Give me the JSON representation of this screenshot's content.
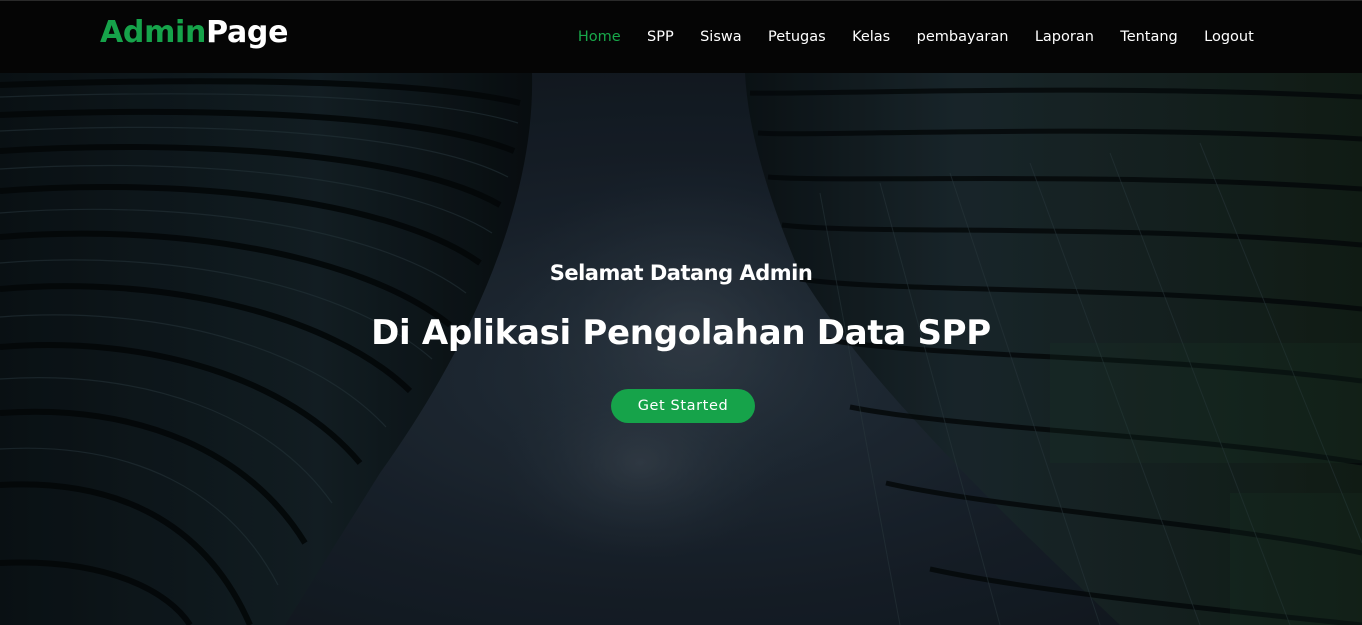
{
  "brand": {
    "part1": "Admin",
    "part2": "Page"
  },
  "nav": {
    "items": [
      {
        "label": "Home",
        "active": true
      },
      {
        "label": "SPP"
      },
      {
        "label": "Siswa"
      },
      {
        "label": "Petugas"
      },
      {
        "label": "Kelas"
      },
      {
        "label": "pembayaran"
      },
      {
        "label": "Laporan"
      },
      {
        "label": "Tentang"
      },
      {
        "label": "Logout"
      }
    ]
  },
  "hero": {
    "welcome": "Selamat Datang Admin",
    "subtitle": "Di Aplikasi Pengolahan Data SPP",
    "cta_label": "Get Started"
  },
  "colors": {
    "accent": "#16a34a",
    "navbar_bg": "#050505",
    "text": "#ffffff"
  }
}
